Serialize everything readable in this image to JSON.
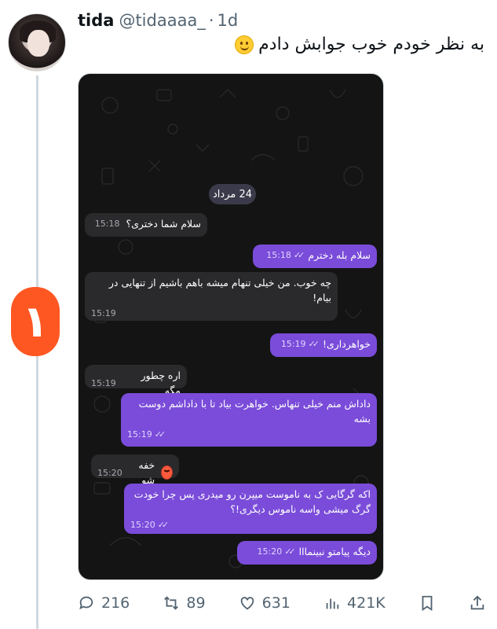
{
  "tweet": {
    "name": "tida",
    "handle": "@tidaaaa_",
    "dot": "·",
    "time": "1d",
    "text": "به نظر خودم خوب جوابش دادم"
  },
  "badge": {
    "text": "۱"
  },
  "chat": {
    "date": "24 مرداد",
    "messages": [
      {
        "dir": "in",
        "text": "سلام شما دختری؟",
        "time": "15:18"
      },
      {
        "dir": "out",
        "text": "سلام بله دخترم",
        "time": "15:18"
      },
      {
        "dir": "in",
        "text": "چه خوب. من خیلی تنهام میشه باهم باشیم از تنهایی در بیام!",
        "time": "15:19"
      },
      {
        "dir": "out",
        "text": "خواهرداری!",
        "time": "15:19"
      },
      {
        "dir": "in",
        "text": "اره چطور مگه",
        "time": "15:19"
      },
      {
        "dir": "out",
        "text": "داداش منم خیلی تنهاس. خواهرت بیاد تا با داداشم دوست بشه",
        "time": "15:19"
      },
      {
        "dir": "in",
        "text": "خفه شو",
        "time": "15:20"
      },
      {
        "dir": "out",
        "text": "اکه گرگایی ک به ناموست میپرن رو میدری پس چرا خودت گرگ میشی واسه ناموس دیگری!؟",
        "time": "15:20"
      },
      {
        "dir": "out",
        "text": "دیگه پیامتو نبینمااا",
        "time": "15:20"
      }
    ]
  },
  "actions": {
    "replies": "216",
    "retweets": "89",
    "likes": "631",
    "views": "421K"
  },
  "icons": [
    "reply-icon",
    "retweet-icon",
    "like-icon",
    "views-icon",
    "bookmark-icon",
    "share-icon"
  ]
}
